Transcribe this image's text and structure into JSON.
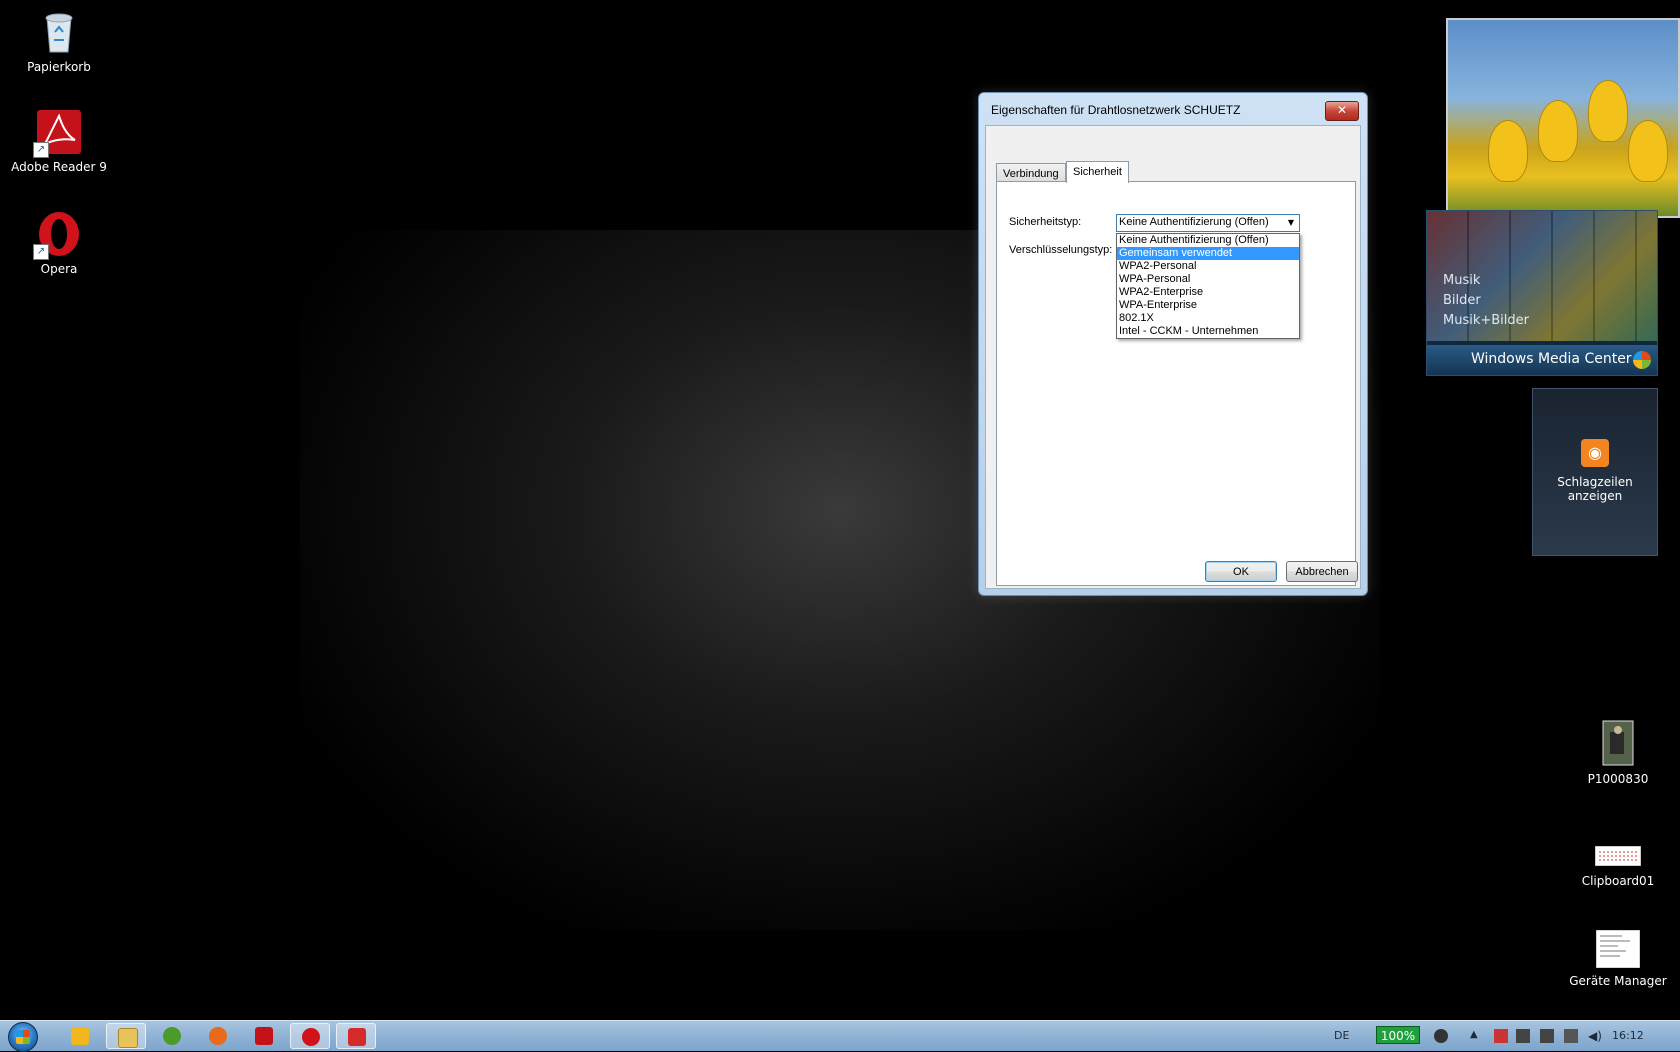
{
  "desktop": {
    "icons": [
      {
        "label": "Papierkorb",
        "icon": "recycle-bin-icon"
      },
      {
        "label": "Adobe Reader 9",
        "icon": "adobe-reader-icon"
      },
      {
        "label": "Opera",
        "icon": "opera-icon"
      },
      {
        "label": "P1000830",
        "icon": "photo-file-icon"
      },
      {
        "label": "Clipboard01",
        "icon": "image-file-icon"
      },
      {
        "label": "Geräte Manager",
        "icon": "document-file-icon"
      }
    ]
  },
  "gadgets": {
    "media_center": {
      "items": [
        "Musik",
        "Bilder",
        "Musik+Bilder"
      ],
      "title": "Windows Media Center"
    },
    "rss": {
      "label": "Schlagzeilen anzeigen"
    }
  },
  "dialog": {
    "title": "Eigenschaften für Drahtlosnetzwerk SCHUETZ",
    "close_glyph": "✕",
    "tabs": [
      "Verbindung",
      "Sicherheit"
    ],
    "active_tab": "Sicherheit",
    "security_type_label": "Sicherheitstyp:",
    "encryption_type_label": "Verschlüsselungstyp:",
    "security_type_value": "Keine Authentifizierung (Offen)",
    "dropdown_options": [
      "Keine Authentifizierung (Offen)",
      "Gemeinsam verwendet",
      "WPA2-Personal",
      "WPA-Personal",
      "WPA2-Enterprise",
      "WPA-Enterprise",
      "802.1X",
      "Intel - CCKM - Unternehmen"
    ],
    "highlighted_option": "Gemeinsam verwendet",
    "ok_label": "OK",
    "cancel_label": "Abbrechen"
  },
  "taskbar": {
    "language": "DE",
    "battery": "100%",
    "clock": "16:12",
    "apps": [
      "media-player-icon",
      "explorer-icon",
      "messenger-icon",
      "firefox-icon",
      "adobe-icon",
      "opera-icon",
      "network-icon"
    ]
  },
  "colors": {
    "selection": "#3399ff",
    "taskbar": "#8fb2d4",
    "dialog_frame": "#b6cfe8"
  }
}
